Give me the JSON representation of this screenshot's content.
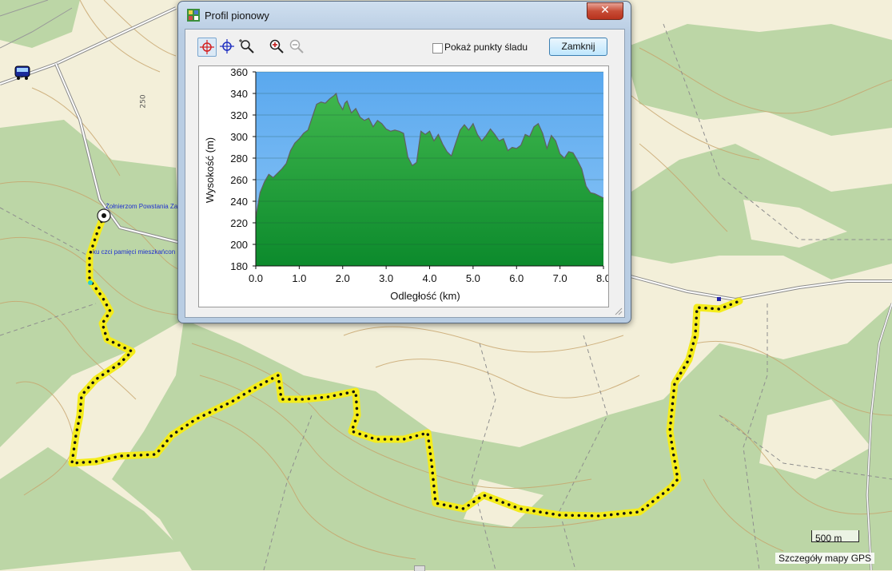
{
  "window": {
    "title": "Profil pionowy",
    "close_glyph": "✕"
  },
  "toolbar": {
    "tools": [
      "crosshair-red-icon",
      "crosshair-blue-icon",
      "zoom-region-icon",
      "zoom-in-icon",
      "zoom-out-icon"
    ],
    "show_points_label": "Pokaż punkty śladu",
    "show_points_checked": false,
    "close_label": "Zamknij"
  },
  "chart_data": {
    "type": "area",
    "xlabel": "Odległość   (km)",
    "ylabel": "Wysokość (m)",
    "xlim": [
      0,
      8.0
    ],
    "ylim": [
      180,
      360
    ],
    "x_ticks": [
      "0.0",
      "1.0",
      "2.0",
      "3.0",
      "4.0",
      "5.0",
      "6.0",
      "7.0",
      "8.0"
    ],
    "y_ticks": [
      "180",
      "200",
      "220",
      "240",
      "260",
      "280",
      "300",
      "320",
      "340",
      "360"
    ],
    "grid": true,
    "colors": {
      "fill_top": "#3fb64d",
      "fill_bottom": "#0c8a2c",
      "line": "#606060",
      "sky_top": "#5aa8ee",
      "sky_bottom": "#8cc6f7"
    },
    "x": [
      0.0,
      0.1,
      0.2,
      0.3,
      0.4,
      0.6,
      0.7,
      0.8,
      0.9,
      1.0,
      1.1,
      1.2,
      1.3,
      1.4,
      1.5,
      1.6,
      1.7,
      1.8,
      1.85,
      1.9,
      2.0,
      2.05,
      2.1,
      2.2,
      2.3,
      2.4,
      2.5,
      2.6,
      2.7,
      2.8,
      2.9,
      3.0,
      3.1,
      3.2,
      3.3,
      3.4,
      3.5,
      3.6,
      3.7,
      3.8,
      3.9,
      4.0,
      4.1,
      4.2,
      4.3,
      4.4,
      4.5,
      4.6,
      4.7,
      4.8,
      4.9,
      5.0,
      5.1,
      5.2,
      5.3,
      5.4,
      5.5,
      5.6,
      5.7,
      5.8,
      5.9,
      6.0,
      6.1,
      6.2,
      6.3,
      6.4,
      6.5,
      6.6,
      6.7,
      6.8,
      6.9,
      7.0,
      7.1,
      7.2,
      7.3,
      7.4,
      7.5,
      7.6,
      7.7,
      7.8,
      7.9,
      8.0
    ],
    "y": [
      225,
      248,
      258,
      265,
      262,
      270,
      275,
      287,
      294,
      298,
      303,
      306,
      318,
      330,
      332,
      331,
      335,
      338,
      340,
      332,
      325,
      331,
      333,
      322,
      326,
      318,
      315,
      317,
      309,
      315,
      312,
      307,
      305,
      306,
      305,
      303,
      281,
      273,
      276,
      305,
      302,
      305,
      296,
      302,
      293,
      286,
      282,
      294,
      306,
      311,
      306,
      312,
      302,
      296,
      301,
      307,
      302,
      296,
      298,
      287,
      290,
      289,
      292,
      302,
      300,
      309,
      312,
      303,
      289,
      301,
      296,
      284,
      280,
      286,
      285,
      278,
      270,
      254,
      248,
      247,
      245,
      243
    ]
  },
  "map": {
    "labels": [
      "Żołnierzom Powstania Za",
      "ku czci pamięci mieszkańcon"
    ],
    "road_number": "250",
    "scale_label": "500 m",
    "credit": "Szczegóły mapy GPS"
  }
}
